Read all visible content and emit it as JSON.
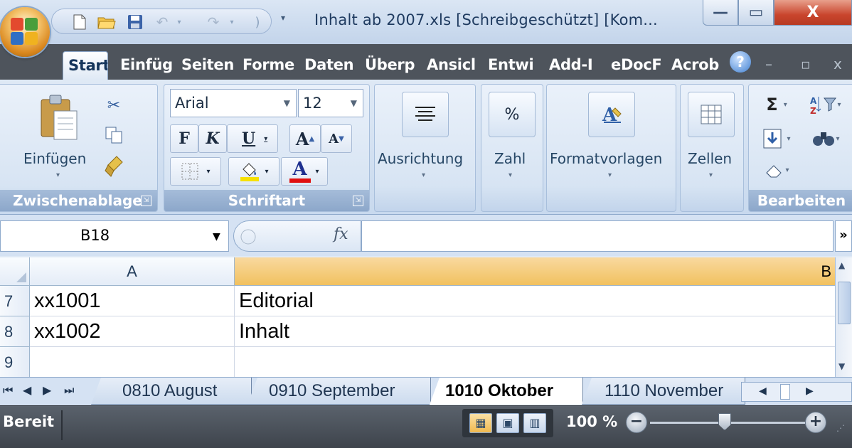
{
  "window": {
    "title": "Inhalt ab 2007.xls  [Schreibgeschützt]  [Kom...",
    "min_label": "—",
    "max_label": "▭",
    "close_label": "X"
  },
  "ribbon_tabs": [
    "Start",
    "Einfüg",
    "Seiten",
    "Forme",
    "Daten",
    "Überp",
    "Ansicl",
    "Entwi",
    "Add-I",
    "eDocF",
    "Acrob"
  ],
  "help_label": "?",
  "clipboard": {
    "paste_label": "Einfügen",
    "group_label": "Zwischenablage"
  },
  "font": {
    "family": "Arial",
    "size": "12",
    "bold_label": "F",
    "italic_label": "K",
    "underline_label": "U",
    "grow_label": "A",
    "shrink_label": "A",
    "font_color_label": "A",
    "group_label": "Schriftart"
  },
  "alignment": {
    "label": "Ausrichtung"
  },
  "number": {
    "label": "Zahl",
    "icon_text": "%"
  },
  "styles": {
    "label": "Formatvorlagen"
  },
  "cells": {
    "label": "Zellen"
  },
  "editing": {
    "group_label": "Bearbeiten",
    "sum_symbol": "Σ"
  },
  "formula_bar": {
    "name_box": "B18",
    "fx": "fx",
    "formula": ""
  },
  "grid": {
    "columns": [
      "A",
      "B"
    ],
    "rows": [
      {
        "num": "7",
        "a": "xx1001",
        "b": "Editorial"
      },
      {
        "num": "8",
        "a": "xx1002",
        "b": "Inhalt"
      },
      {
        "num": "9",
        "a": "",
        "b": ""
      }
    ]
  },
  "sheets": [
    "0810 August",
    "0910 September",
    "1010 Oktober",
    "1110 November"
  ],
  "active_sheet": "1010 Oktober",
  "status": {
    "text": "Bereit",
    "zoom": "100 %",
    "zoom_level_percent": 100
  },
  "colors": {
    "tab_strip": "#4e545c",
    "active_column": "#f1c15f",
    "status_bar": "#4b525a"
  }
}
